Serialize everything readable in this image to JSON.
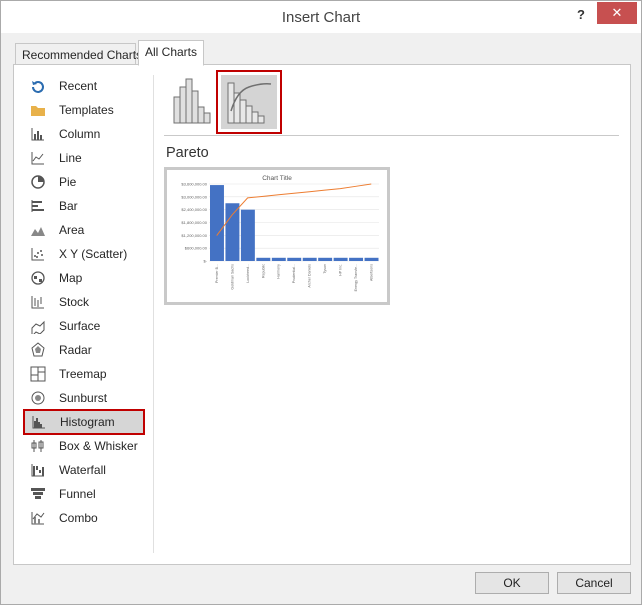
{
  "dialog": {
    "title": "Insert Chart",
    "help_label": "?",
    "close_label": "✕"
  },
  "tabs": [
    {
      "label": "Recommended Charts",
      "selected": false
    },
    {
      "label": "All Charts",
      "selected": true
    }
  ],
  "sidebar": {
    "items": [
      {
        "label": "Recent",
        "icon": "recent-icon"
      },
      {
        "label": "Templates",
        "icon": "templates-icon"
      },
      {
        "label": "Column",
        "icon": "column-chart-icon"
      },
      {
        "label": "Line",
        "icon": "line-chart-icon"
      },
      {
        "label": "Pie",
        "icon": "pie-chart-icon"
      },
      {
        "label": "Bar",
        "icon": "bar-chart-icon"
      },
      {
        "label": "Area",
        "icon": "area-chart-icon"
      },
      {
        "label": "X Y (Scatter)",
        "icon": "scatter-chart-icon"
      },
      {
        "label": "Map",
        "icon": "map-chart-icon"
      },
      {
        "label": "Stock",
        "icon": "stock-chart-icon"
      },
      {
        "label": "Surface",
        "icon": "surface-chart-icon"
      },
      {
        "label": "Radar",
        "icon": "radar-chart-icon"
      },
      {
        "label": "Treemap",
        "icon": "treemap-chart-icon"
      },
      {
        "label": "Sunburst",
        "icon": "sunburst-chart-icon"
      },
      {
        "label": "Histogram",
        "icon": "histogram-chart-icon",
        "selected": true
      },
      {
        "label": "Box & Whisker",
        "icon": "box-whisker-chart-icon"
      },
      {
        "label": "Waterfall",
        "icon": "waterfall-chart-icon"
      },
      {
        "label": "Funnel",
        "icon": "funnel-chart-icon"
      },
      {
        "label": "Combo",
        "icon": "combo-chart-icon"
      }
    ]
  },
  "main": {
    "subtypes": [
      {
        "icon": "histogram-subtype-icon",
        "selected": false
      },
      {
        "icon": "pareto-subtype-icon",
        "selected": true
      }
    ],
    "selected_name": "Pareto"
  },
  "preview": {
    "chart_data": {
      "type": "bar",
      "title": "Chart Title",
      "categories": [
        "Premier B...",
        "Goldman Sachs",
        "Lockheed...",
        "Republic",
        "Harmony",
        "Prudential...",
        "Archer Daniels",
        "Tyson",
        "HP Inc.",
        "Energy Transfe...",
        "Albertsons"
      ],
      "series": [
        {
          "values": [
            3550000,
            2700000,
            2400000,
            150000,
            150000,
            150000,
            150000,
            150000,
            150000,
            150000,
            150000
          ]
        },
        {
          "type": "line",
          "values": [
            0.33,
            0.6,
            0.82,
            0.84,
            0.86,
            0.88,
            0.9,
            0.92,
            0.94,
            0.97,
            1.0
          ]
        }
      ],
      "yticks": [
        "$3,600,000.00",
        "$3,000,000.00",
        "$2,400,000.00",
        "$1,800,000.00",
        "$1,200,000.00",
        "$600,000.00",
        "$-"
      ],
      "ylim": [
        0,
        3600000
      ],
      "colors": {
        "bars": "#4472c4",
        "line": "#ed7d31"
      }
    }
  },
  "buttons": {
    "ok": "OK",
    "cancel": "Cancel"
  }
}
